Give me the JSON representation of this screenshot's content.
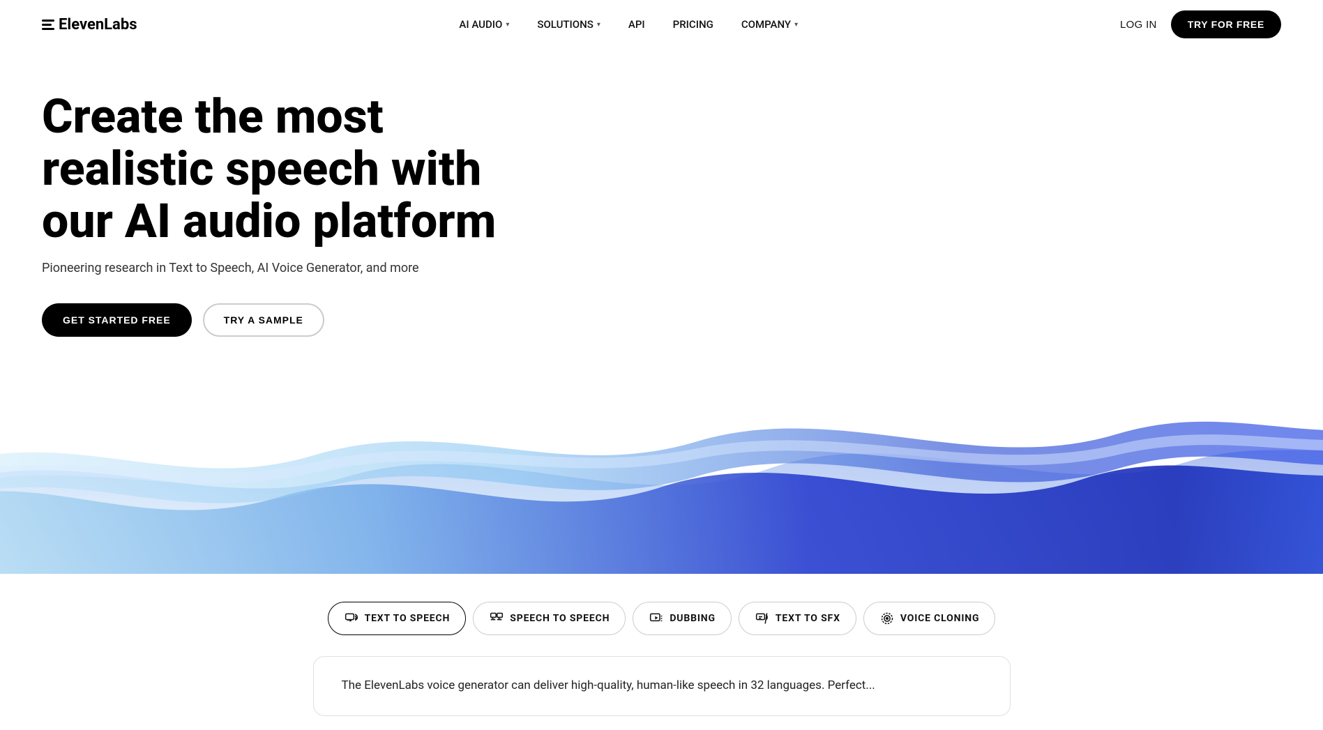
{
  "nav": {
    "logo_text": "ElevenLabs",
    "items": [
      {
        "label": "AI AUDIO",
        "has_dropdown": true
      },
      {
        "label": "SOLUTIONS",
        "has_dropdown": true
      },
      {
        "label": "API",
        "has_dropdown": false
      },
      {
        "label": "PRICING",
        "has_dropdown": false
      },
      {
        "label": "COMPANY",
        "has_dropdown": true
      }
    ],
    "login_label": "LOG IN",
    "try_free_label": "TRY FOR FREE"
  },
  "hero": {
    "title": "Create the most realistic speech with our AI audio platform",
    "subtitle": "Pioneering research in Text to Speech, AI Voice Generator, and more",
    "get_started_label": "GET STARTED FREE",
    "try_sample_label": "TRY A SAMPLE"
  },
  "tabs": [
    {
      "label": "TEXT TO SPEECH",
      "icon": "tts-icon",
      "active": true
    },
    {
      "label": "SPEECH TO SPEECH",
      "icon": "sts-icon",
      "active": false
    },
    {
      "label": "DUBBING",
      "icon": "dub-icon",
      "active": false
    },
    {
      "label": "TEXT TO SFX",
      "icon": "sfx-icon",
      "active": false
    },
    {
      "label": "VOICE CLONING",
      "icon": "vc-icon",
      "active": false
    }
  ],
  "description": "The ElevenLabs voice generator can deliver high-quality, human-like speech in 32 languages. Perfect..."
}
